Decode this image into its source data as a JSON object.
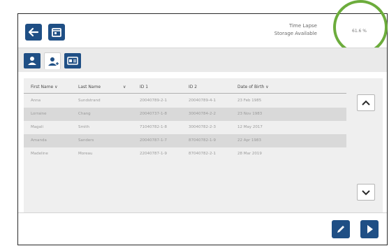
{
  "status": {
    "line1": "Time Lapse",
    "line2": "Storage Available",
    "storage_value": "61.6 %"
  },
  "icons": {
    "back": "arrow-left-icon",
    "calendar": "calendar-icon",
    "user": "user-icon",
    "user_add": "user-add-icon",
    "id_card": "id-card-icon",
    "scroll_up": "chevron-up-icon",
    "scroll_down": "chevron-down-icon",
    "edit": "pencil-icon",
    "next": "play-icon"
  },
  "colors": {
    "primary": "#1f4f85",
    "highlight_ring": "#6cac3c",
    "row_alt": "#d9d9d9"
  },
  "table": {
    "columns": [
      "First Name ∨",
      "Last Name",
      "∨",
      "ID 1",
      "ID 2",
      "Date of Birth ∨"
    ],
    "rows": [
      {
        "first": "Anna",
        "last": "Sundstrand",
        "id1": "20040789-2-1",
        "id2": "20040789-4-1",
        "dob": "23 Feb 1985"
      },
      {
        "first": "Lorraine",
        "last": "Chang",
        "id1": "20040737-1-8",
        "id2": "30040784-2-2",
        "dob": "23 Nov 1983"
      },
      {
        "first": "Magali",
        "last": "Smith",
        "id1": "71040782-1-8",
        "id2": "30040782-2-3",
        "dob": "12 May 2017"
      },
      {
        "first": "Amanda",
        "last": "Sanders",
        "id1": "20040787-1-7",
        "id2": "87040782-1-9",
        "dob": "22 Apr 1983"
      },
      {
        "first": "Madeline",
        "last": "Moreau",
        "id1": "22040787-1-9",
        "id2": "87040782-2-1",
        "dob": "28 Mar 2019"
      }
    ]
  }
}
